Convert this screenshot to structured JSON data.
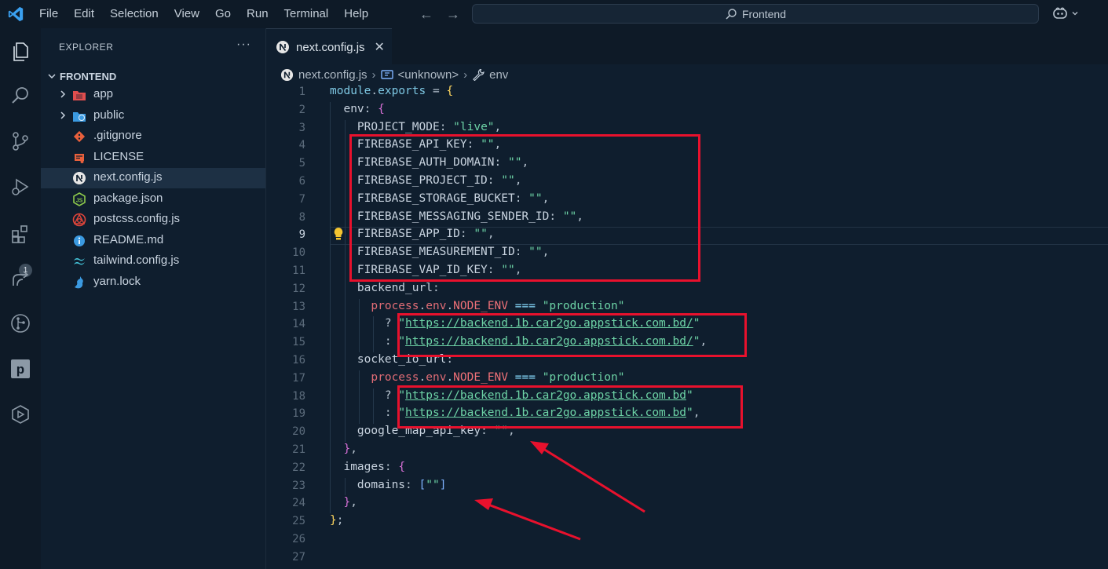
{
  "menu": [
    "File",
    "Edit",
    "Selection",
    "View",
    "Go",
    "Run",
    "Terminal",
    "Help"
  ],
  "command_center": "Frontend",
  "activity_badge": "1",
  "explorer": {
    "header": "EXPLORER",
    "more": "···",
    "root": "FRONTEND",
    "items": [
      {
        "name": "app",
        "folder": true,
        "icon": "folder-app-icon",
        "color": "#e04e4e"
      },
      {
        "name": "public",
        "folder": true,
        "icon": "folder-public-icon",
        "color": "#3b9ae1"
      },
      {
        "name": ".gitignore",
        "folder": false,
        "icon": "git-icon",
        "color": "#e8603c"
      },
      {
        "name": "LICENSE",
        "folder": false,
        "icon": "license-icon",
        "color": "#e8603c"
      },
      {
        "name": "next.config.js",
        "folder": false,
        "icon": "nextjs-icon",
        "color": "#e6e6e6",
        "selected": true
      },
      {
        "name": "package.json",
        "folder": false,
        "icon": "nodejs-icon",
        "color": "#8cc84b"
      },
      {
        "name": "postcss.config.js",
        "folder": false,
        "icon": "postcss-icon",
        "color": "#e0453a"
      },
      {
        "name": "README.md",
        "folder": false,
        "icon": "info-icon",
        "color": "#3b9ae1"
      },
      {
        "name": "tailwind.config.js",
        "folder": false,
        "icon": "tailwind-icon",
        "color": "#44c3d8"
      },
      {
        "name": "yarn.lock",
        "folder": false,
        "icon": "yarn-icon",
        "color": "#3b9ae1"
      }
    ]
  },
  "tab": {
    "name": "next.config.js",
    "close": "✕"
  },
  "breadcrumb": [
    "next.config.js",
    "<unknown>",
    "env"
  ],
  "active_line": 9,
  "code": [
    [
      [
        "tk-kw",
        "module"
      ],
      [
        "tk-punc",
        "."
      ],
      [
        "tk-kw",
        "exports"
      ],
      [
        "tk-punc",
        " = "
      ],
      [
        "tk-yellow",
        "{"
      ]
    ],
    [
      [
        "tk-prop",
        "  env"
      ],
      [
        "tk-punc",
        ": "
      ],
      [
        "tk-brace",
        "{"
      ]
    ],
    [
      [
        "tk-prop",
        "    PROJECT_MODE"
      ],
      [
        "tk-punc",
        ": "
      ],
      [
        "tk-str",
        "\"live\""
      ],
      [
        "tk-punc",
        ","
      ]
    ],
    [
      [
        "tk-prop",
        "    FIREBASE_API_KEY"
      ],
      [
        "tk-punc",
        ": "
      ],
      [
        "tk-str",
        "\"\""
      ],
      [
        "tk-punc",
        ","
      ]
    ],
    [
      [
        "tk-prop",
        "    FIREBASE_AUTH_DOMAIN"
      ],
      [
        "tk-punc",
        ": "
      ],
      [
        "tk-str",
        "\"\""
      ],
      [
        "tk-punc",
        ","
      ]
    ],
    [
      [
        "tk-prop",
        "    FIREBASE_PROJECT_ID"
      ],
      [
        "tk-punc",
        ": "
      ],
      [
        "tk-str",
        "\"\""
      ],
      [
        "tk-punc",
        ","
      ]
    ],
    [
      [
        "tk-prop",
        "    FIREBASE_STORAGE_BUCKET"
      ],
      [
        "tk-punc",
        ": "
      ],
      [
        "tk-str",
        "\"\""
      ],
      [
        "tk-punc",
        ","
      ]
    ],
    [
      [
        "tk-prop",
        "    FIREBASE_MESSAGING_SENDER_ID"
      ],
      [
        "tk-punc",
        ": "
      ],
      [
        "tk-str",
        "\"\""
      ],
      [
        "tk-punc",
        ","
      ]
    ],
    [
      [
        "tk-prop",
        "    FIREBASE_APP_ID"
      ],
      [
        "tk-punc",
        ": "
      ],
      [
        "tk-str",
        "\"\""
      ],
      [
        "tk-punc",
        ","
      ]
    ],
    [
      [
        "tk-prop",
        "    FIREBASE_MEASUREMENT_ID"
      ],
      [
        "tk-punc",
        ": "
      ],
      [
        "tk-str",
        "\"\""
      ],
      [
        "tk-punc",
        ","
      ]
    ],
    [
      [
        "tk-prop",
        "    FIREBASE_VAP_ID_KEY"
      ],
      [
        "tk-punc",
        ": "
      ],
      [
        "tk-str",
        "\"\""
      ],
      [
        "tk-punc",
        ","
      ]
    ],
    [
      [
        "tk-prop",
        "    backend_url"
      ],
      [
        "tk-punc",
        ":"
      ]
    ],
    [
      [
        "tk-fn",
        "      process"
      ],
      [
        "tk-punc",
        "."
      ],
      [
        "tk-fn",
        "env"
      ],
      [
        "tk-punc",
        "."
      ],
      [
        "tk-pink",
        "NODE_ENV"
      ],
      [
        "tk-punc",
        " "
      ],
      [
        "tk-op",
        "==="
      ],
      [
        "tk-punc",
        " "
      ],
      [
        "tk-str",
        "\"production\""
      ]
    ],
    [
      [
        "tk-punc",
        "        ? "
      ],
      [
        "tk-str",
        "\""
      ],
      [
        "tk-link",
        "https://backend.1b.car2go.appstick.com.bd/"
      ],
      [
        "tk-str",
        "\""
      ]
    ],
    [
      [
        "tk-punc",
        "        : "
      ],
      [
        "tk-str",
        "\""
      ],
      [
        "tk-link",
        "https://backend.1b.car2go.appstick.com.bd/"
      ],
      [
        "tk-str",
        "\""
      ],
      [
        "tk-punc",
        ","
      ]
    ],
    [
      [
        "tk-prop",
        "    socket_io_url"
      ],
      [
        "tk-punc",
        ":"
      ]
    ],
    [
      [
        "tk-fn",
        "      process"
      ],
      [
        "tk-punc",
        "."
      ],
      [
        "tk-fn",
        "env"
      ],
      [
        "tk-punc",
        "."
      ],
      [
        "tk-pink",
        "NODE_ENV"
      ],
      [
        "tk-punc",
        " "
      ],
      [
        "tk-op",
        "==="
      ],
      [
        "tk-punc",
        " "
      ],
      [
        "tk-str",
        "\"production\""
      ]
    ],
    [
      [
        "tk-punc",
        "        ? "
      ],
      [
        "tk-str",
        "\""
      ],
      [
        "tk-link",
        "https://backend.1b.car2go.appstick.com.bd"
      ],
      [
        "tk-str",
        "\""
      ]
    ],
    [
      [
        "tk-punc",
        "        : "
      ],
      [
        "tk-str",
        "\""
      ],
      [
        "tk-link",
        "https://backend.1b.car2go.appstick.com.bd"
      ],
      [
        "tk-str",
        "\""
      ],
      [
        "tk-punc",
        ","
      ]
    ],
    [
      [
        "tk-prop",
        "    google_map_api_key"
      ],
      [
        "tk-punc",
        ": "
      ],
      [
        "tk-str",
        "\"\""
      ],
      [
        "tk-punc",
        ","
      ]
    ],
    [
      [
        "tk-brace",
        "  }"
      ],
      [
        "tk-punc",
        ","
      ]
    ],
    [
      [
        "tk-prop",
        "  images"
      ],
      [
        "tk-punc",
        ": "
      ],
      [
        "tk-brace",
        "{"
      ]
    ],
    [
      [
        "tk-prop",
        "    domains"
      ],
      [
        "tk-punc",
        ": "
      ],
      [
        "tk-blue",
        "["
      ],
      [
        "tk-str",
        "\"\""
      ],
      [
        "tk-blue",
        "]"
      ]
    ],
    [
      [
        "tk-brace",
        "  }"
      ],
      [
        "tk-punc",
        ","
      ]
    ],
    [
      [
        "tk-yellow",
        "}"
      ],
      [
        "tk-punc",
        ";"
      ]
    ],
    [],
    []
  ],
  "colors": {
    "annotation_red": "#e8112d",
    "background": "#0f1e2e",
    "selection": "#1d3044"
  }
}
